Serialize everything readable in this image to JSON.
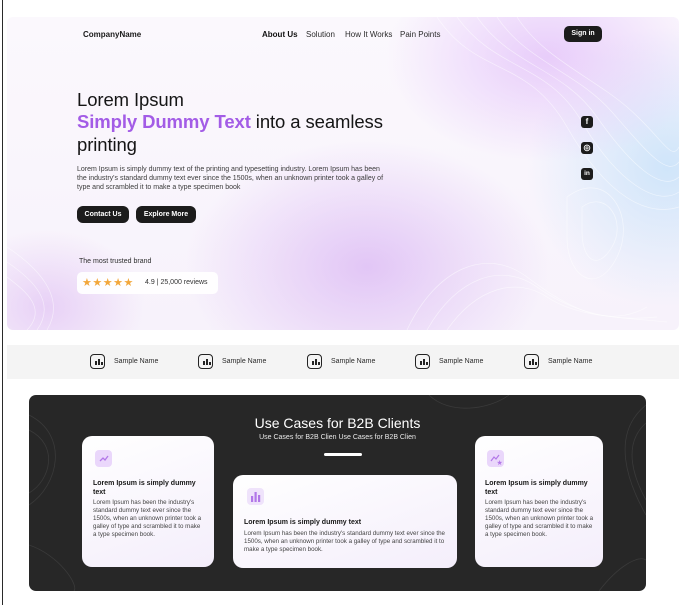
{
  "header": {
    "brand": "CompanyName",
    "nav": [
      "About Us",
      "Solution",
      "How It Works",
      "Pain Points"
    ],
    "signin": "Sign in"
  },
  "hero": {
    "line1": "Lorem Ipsum",
    "line2_accent": "Simply Dummy Text",
    "line2_rest": " into a seamless",
    "line3": "printing",
    "lead": "Lorem Ipsum is simply dummy text of the printing and typesetting industry. Lorem Ipsum has been the industry's standard dummy text ever since the 1500s, when an unknown printer took a galley of type and scrambled it to make a type specimen book",
    "contact_label": "Contact Us",
    "explore_label": "Explore More",
    "trusted": "The most trusted brand",
    "stars": "★★★★★",
    "rating": 4.9,
    "rating_text": "4.9 | 25,000 reviews",
    "accent_color": "#a35ce6"
  },
  "social": [
    {
      "icon": "facebook-icon",
      "glyph": "f"
    },
    {
      "icon": "instagram-icon",
      "glyph": "◎"
    },
    {
      "icon": "linkedin-icon",
      "glyph": "in"
    }
  ],
  "logos": [
    "Sample Name",
    "Sample Name",
    "Sample Name",
    "Sample Name",
    "Sample Name"
  ],
  "usecases": {
    "title": "Use Cases for B2B Clients",
    "subtitle": "Use Cases for B2B Clien Use Cases for B2B Clien",
    "cards": [
      {
        "icon": "trend-chart-icon",
        "title": "Lorem Ipsum is simply dummy text",
        "body": "Lorem Ipsum has been the industry's standard dummy text ever since the 1500s, when an unknown printer took a galley of type and scrambled it to make a type specimen book."
      },
      {
        "icon": "bar-chart-icon",
        "title": "Lorem Ipsum is simply dummy text",
        "body": "Lorem Ipsum has been the industry's standard dummy text ever since the 1500s, when an unknown printer took a galley of type and scrambled it to make a type specimen book."
      },
      {
        "icon": "chart-star-icon",
        "title": "Lorem Ipsum is simply dummy text",
        "body": "Lorem Ipsum has been the industry's standard dummy text ever since the 1500s, when an unknown printer took a galley of type and scrambled it to make a type specimen book."
      }
    ]
  }
}
